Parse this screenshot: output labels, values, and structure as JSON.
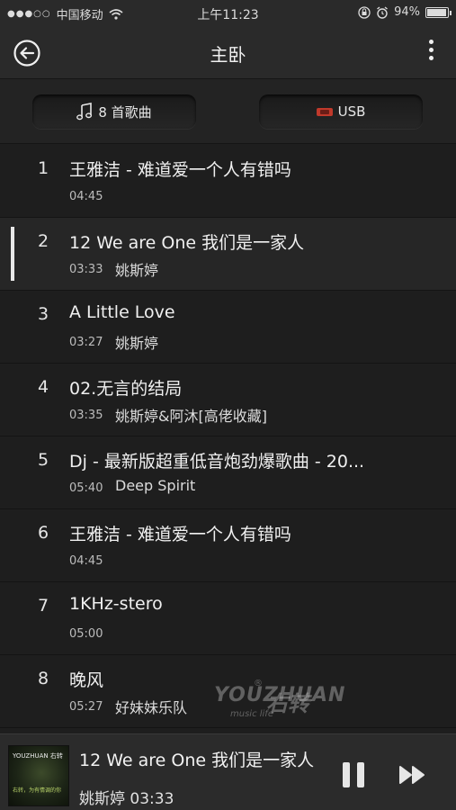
{
  "status_bar": {
    "carrier": "中国移动",
    "time": "上午11:23",
    "battery": "94%",
    "battery_level": 0.94
  },
  "nav": {
    "title": "主卧",
    "back_icon": "back-circle-arrow-icon",
    "more_icon": "more-vertical-icon"
  },
  "source": {
    "songs_label": "8 首歌曲",
    "usb_label": "USB"
  },
  "songs": [
    {
      "num": "1",
      "title": "王雅洁 - 难道爱一个人有错吗",
      "duration": "04:45",
      "artist": ""
    },
    {
      "num": "2",
      "title": "12 We are One 我们是一家人",
      "duration": "03:33",
      "artist": "姚斯婷"
    },
    {
      "num": "3",
      "title": "A Little Love",
      "duration": "03:27",
      "artist": "姚斯婷"
    },
    {
      "num": "4",
      "title": "02.无言的结局",
      "duration": "03:35",
      "artist": "姚斯婷&阿沐[高佬收藏]"
    },
    {
      "num": "5",
      "title": "Dj - 最新版超重低音炮劲爆歌曲 - 20...",
      "duration": "05:40",
      "artist": "Deep Spirit"
    },
    {
      "num": "6",
      "title": "王雅洁 - 难道爱一个人有错吗",
      "duration": "04:45",
      "artist": ""
    },
    {
      "num": "7",
      "title": "1KHz-stero",
      "duration": "05:00",
      "artist": ""
    },
    {
      "num": "8",
      "title": "晚风",
      "duration": "05:27",
      "artist": "好妹妹乐队"
    }
  ],
  "active_index": 1,
  "watermark": {
    "brand": "YOUZHUAN",
    "brand_cn": "右转",
    "sub": "music life",
    "reg": "®"
  },
  "now_playing": {
    "title": "12 We are One 我们是一家人",
    "artist": "姚斯婷",
    "time": "03:33",
    "album_top": "YOUZHUAN 右转",
    "album_mid": "右转，为有情调的你",
    "pause_icon": "pause-icon",
    "next_icon": "next-track-icon"
  },
  "colors": {
    "background": "#1e1e1e",
    "bar": "#2a2a2a",
    "text": "#f0f0f0",
    "usb_accent": "#c0392b"
  }
}
